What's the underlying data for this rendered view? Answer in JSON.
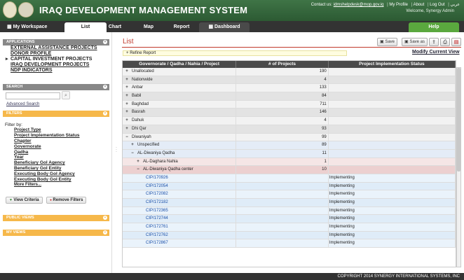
{
  "header": {
    "title": "IRAQ DEVELOPMENT MANAGEMENT SYSTEM",
    "contact_label": "Contact us:",
    "contact_email": "idmshelpdesk@mop.gov.iq",
    "links": [
      "My Profile",
      "About",
      "Log Out"
    ],
    "language": "عربي",
    "welcome": "Welcome, Synergy Admin"
  },
  "tabs": {
    "workspace": "My Workspace",
    "list": "List",
    "chart": "Chart",
    "map": "Map",
    "report": "Report",
    "dashboard": "Dashboard",
    "help": "Help"
  },
  "sidebar": {
    "applications_title": "APPLICATIONS",
    "applications": [
      "EXTERNAL ASSISTANCE PROJECTS",
      "DONOR PROFILE",
      "CAPITAL INVESTMENT PROJECTS",
      "IRAQ DEVELOPMENT PROJECTS",
      "NDP INDICATORS"
    ],
    "search_title": "SEARCH",
    "advanced_search": "Advanced Search",
    "filters_title": "FILTERS",
    "filter_by": "Filter by:",
    "filters": [
      "Project Type",
      "Project Implementation Status",
      "Chapter",
      "Governorate",
      "Qadha",
      "Year",
      "Beneficiary GoI Agency",
      "Beneficiary GoI Entity",
      "Executing Body GoI Agency",
      "Executing Body GoI Entity"
    ],
    "more_filters": "More Filters...",
    "view_criteria": "View Criteria",
    "remove_filters": "Remove Filters",
    "public_views": "PUBLIC VIEWS",
    "my_views": "MY VIEWS"
  },
  "main": {
    "title": "List",
    "save": "Save",
    "save_as": "Save as",
    "modify": "Modify Current View",
    "refine": "Refine Report",
    "columns": [
      "Governorate / Qadha / Nahia / Project",
      "# of Projects",
      "Project Implementation Status"
    ],
    "rows": [
      {
        "label": "Unallocated",
        "count": "190",
        "status": "",
        "exp": "+",
        "level": 0,
        "style": "g0"
      },
      {
        "label": "Nationwide",
        "count": "4",
        "status": "",
        "exp": "+",
        "level": 0,
        "style": "g1"
      },
      {
        "label": "Anbar",
        "count": "133",
        "status": "",
        "exp": "+",
        "level": 0,
        "style": "g0"
      },
      {
        "label": "Babil",
        "count": "84",
        "status": "",
        "exp": "+",
        "level": 0,
        "style": "g1"
      },
      {
        "label": "Baghdad",
        "count": "711",
        "status": "",
        "exp": "+",
        "level": 0,
        "style": "g0"
      },
      {
        "label": "Basrah",
        "count": "146",
        "status": "",
        "exp": "+",
        "level": 0,
        "style": "g1"
      },
      {
        "label": "Dahuk",
        "count": "4",
        "status": "",
        "exp": "+",
        "level": 0,
        "style": "g0"
      },
      {
        "label": "Dhi Qar",
        "count": "93",
        "status": "",
        "exp": "+",
        "level": 0,
        "style": "g1"
      },
      {
        "label": "Diwaniyah",
        "count": "99",
        "status": "",
        "exp": "−",
        "level": 0,
        "style": "g0"
      },
      {
        "label": "Unspecified",
        "count": "89",
        "status": "",
        "exp": "+",
        "level": 1,
        "style": "blue"
      },
      {
        "label": "AL-Diwaniya Qadha",
        "count": "11",
        "status": "",
        "exp": "−",
        "level": 1,
        "style": "blue"
      },
      {
        "label": "AL-Daghara Nahia",
        "count": "1",
        "status": "",
        "exp": "+",
        "level": 2,
        "style": "pink"
      },
      {
        "label": "AL-Diwaniya Qadha center",
        "count": "10",
        "status": "",
        "exp": "−",
        "level": 2,
        "style": "pinkdk"
      },
      {
        "label": "CIP/170926",
        "count": "",
        "status": "Implementing",
        "exp": "",
        "level": 3,
        "style": "cip"
      },
      {
        "label": "CIP/172054",
        "count": "",
        "status": "Implementing",
        "exp": "",
        "level": 3,
        "style": "cip"
      },
      {
        "label": "CIP/172082",
        "count": "",
        "status": "Implementing",
        "exp": "",
        "level": 3,
        "style": "cip"
      },
      {
        "label": "CIP/172182",
        "count": "",
        "status": "Implementing",
        "exp": "",
        "level": 3,
        "style": "cip"
      },
      {
        "label": "CIP/172365",
        "count": "",
        "status": "Implementing",
        "exp": "",
        "level": 3,
        "style": "cip"
      },
      {
        "label": "CIP/172744",
        "count": "",
        "status": "Implementing",
        "exp": "",
        "level": 3,
        "style": "cip"
      },
      {
        "label": "CIP/172761",
        "count": "",
        "status": "Implementing",
        "exp": "",
        "level": 3,
        "style": "cip"
      },
      {
        "label": "CIP/172762",
        "count": "",
        "status": "Implementing",
        "exp": "",
        "level": 3,
        "style": "cip"
      },
      {
        "label": "CIP/172867",
        "count": "",
        "status": "Implementing",
        "exp": "",
        "level": 3,
        "style": "cip"
      }
    ]
  },
  "footer": "COPYRIGHT 2014 SYNERGY INTERNATIONAL SYSTEMS, INC",
  "colors": {
    "header_green": "#2c5a33",
    "accent_red": "#c0392b",
    "filter_orange": "#f6b84a",
    "help_green": "#5aa83e"
  }
}
